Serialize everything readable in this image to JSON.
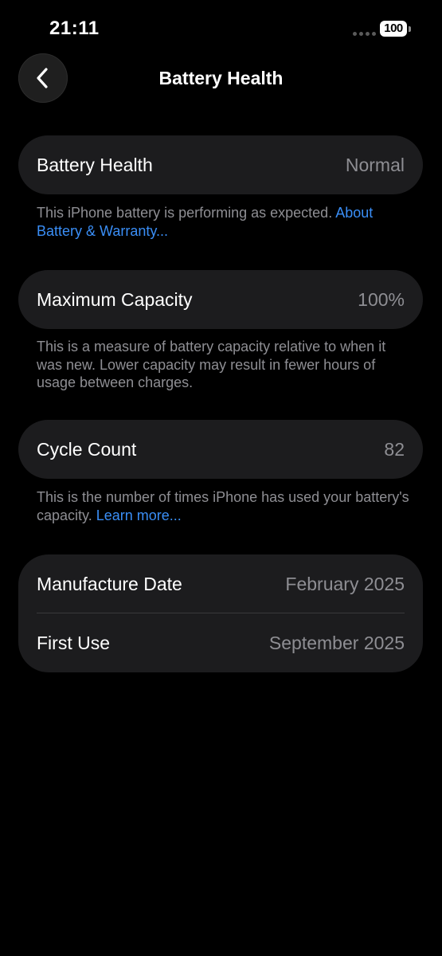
{
  "status_bar": {
    "time": "21:11",
    "battery_level": "100"
  },
  "nav": {
    "title": "Battery Health",
    "back_icon": "chevron-left-icon"
  },
  "battery_health": {
    "label": "Battery Health",
    "value": "Normal",
    "footer_text": "This iPhone battery is performing as expected. ",
    "footer_link": "About Battery & Warranty..."
  },
  "maximum_capacity": {
    "label": "Maximum Capacity",
    "value": "100%",
    "footer_text": "This is a measure of battery capacity relative to when it was new. Lower capacity may result in fewer hours of usage between charges."
  },
  "cycle_count": {
    "label": "Cycle Count",
    "value": "82",
    "footer_text": "This is the number of times iPhone has used your battery's capacity. ",
    "footer_link": "Learn more..."
  },
  "dates": {
    "manufacture_label": "Manufacture Date",
    "manufacture_value": "February 2025",
    "first_use_label": "First Use",
    "first_use_value": "September 2025"
  },
  "colors": {
    "background": "#000000",
    "card": "#1c1c1e",
    "secondary_text": "#8e8e93",
    "link": "#3a8ef6"
  }
}
